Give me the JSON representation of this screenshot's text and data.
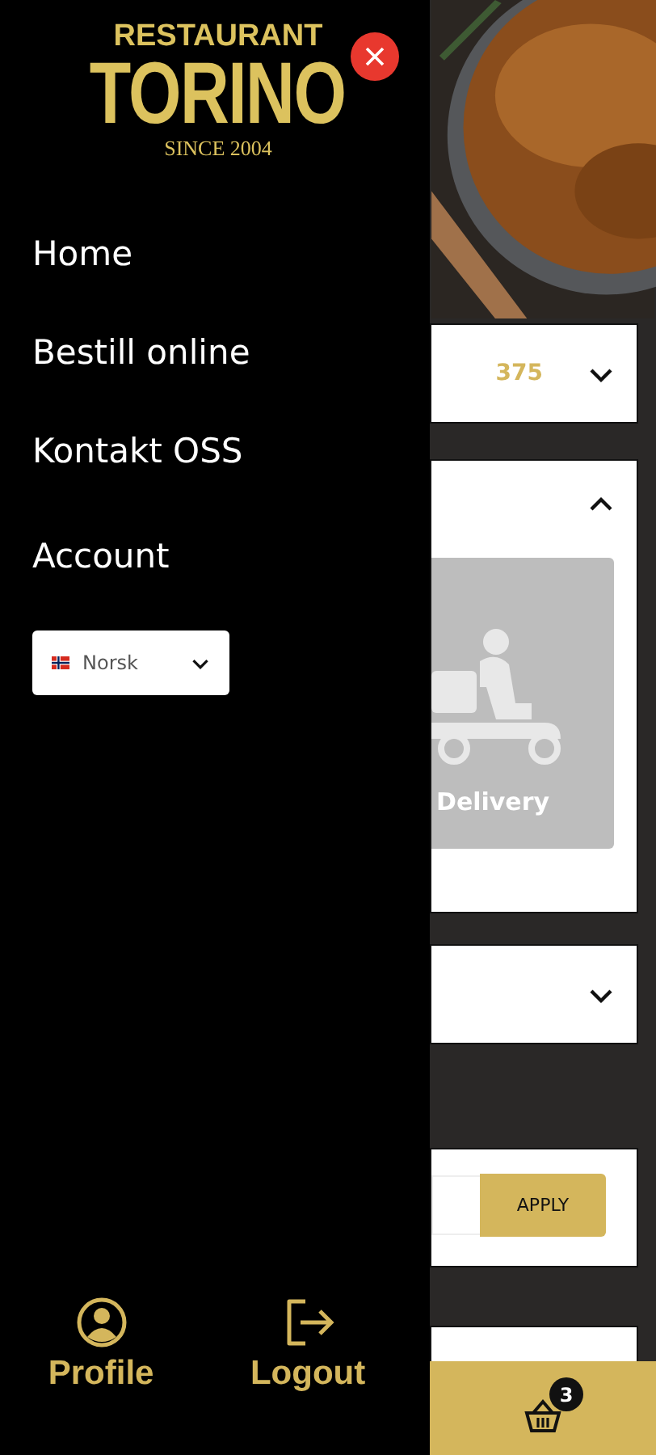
{
  "drawer": {
    "logo": {
      "line_1": "RESTAURANT",
      "line_2": "TORINO",
      "line_3": "SINCE 2004"
    },
    "menu": [
      {
        "label": "Home"
      },
      {
        "label": "Bestill online"
      },
      {
        "label": "Kontakt OSS"
      },
      {
        "label": "Account"
      }
    ],
    "language": {
      "value": "Norsk"
    },
    "footer": [
      {
        "label": "Profile",
        "kind": "profile"
      },
      {
        "label": "Logout",
        "kind": "logout"
      }
    ]
  },
  "background": {
    "cards": [
      {
        "kind": "select",
        "value": "375",
        "expanded": false
      },
      {
        "kind": "options",
        "expanded": true,
        "option": "Delivery"
      },
      {
        "kind": "select",
        "expanded": false
      },
      {
        "kind": "coupon",
        "button": "APPLY"
      },
      {
        "kind": "blank"
      }
    ],
    "cart": {
      "count": "3"
    }
  }
}
